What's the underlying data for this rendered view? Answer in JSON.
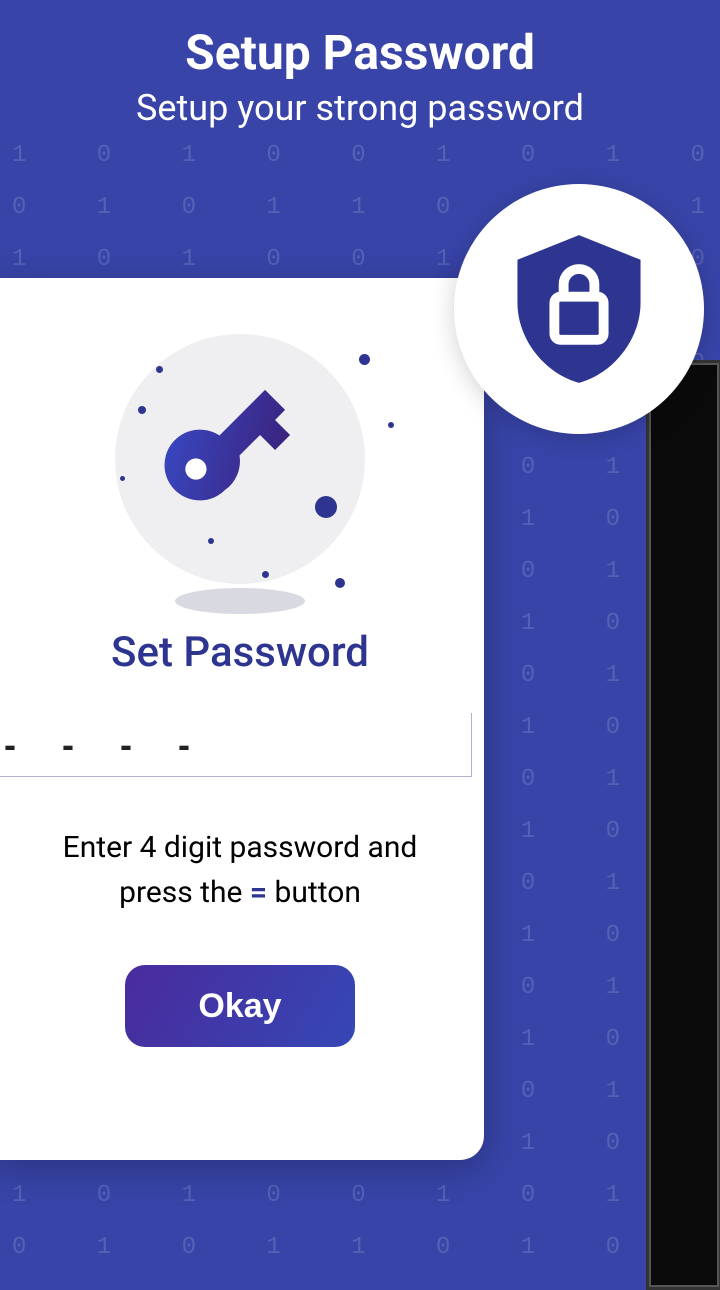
{
  "header": {
    "title": "Setup Password",
    "subtitle": "Setup your strong password"
  },
  "card": {
    "title": "Set Password",
    "input_placeholder": "- - - -",
    "hint_pre": "Enter 4 digit password and press the ",
    "hint_symbol": "=",
    "hint_post": " button",
    "button_label": "Okay"
  },
  "colors": {
    "brand": "#3844a8",
    "accent": "#2e3590"
  }
}
